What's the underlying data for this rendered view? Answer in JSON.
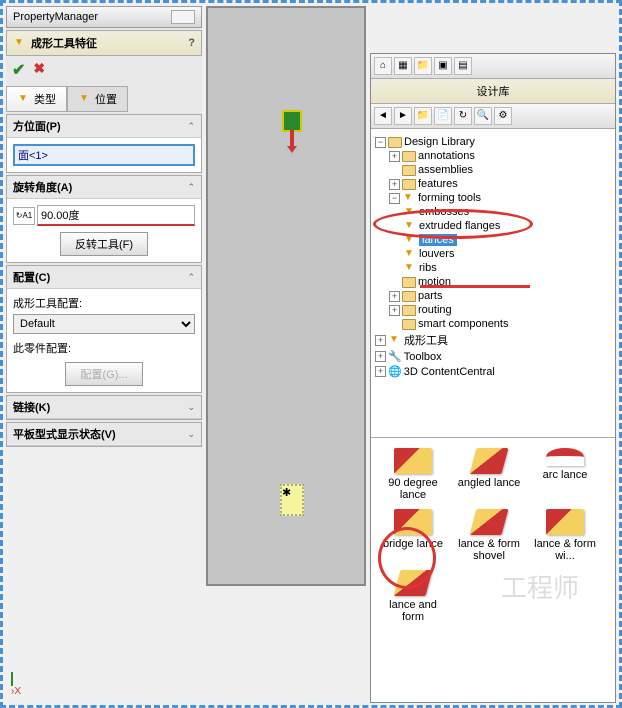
{
  "pm": {
    "title": "PropertyManager",
    "feature_title": "成形工具特征",
    "tab_type": "类型",
    "tab_position": "位置",
    "sec_face": "方位面(P)",
    "face_value": "面<1>",
    "sec_angle": "旋转角度(A)",
    "angle_value": "90.00度",
    "reverse_btn": "反转工具(F)",
    "sec_config": "配置(C)",
    "config_label": "成形工具配置:",
    "config_default": "Default",
    "part_config_label": "此零件配置:",
    "config_btn": "配置(G)...",
    "sec_link": "链接(K)",
    "sec_flat": "平板型式显示状态(V)"
  },
  "lib": {
    "title": "设计库",
    "root": "Design Library",
    "items": [
      "annotations",
      "assemblies",
      "features",
      "forming tools",
      "embosses",
      "extruded flanges",
      "lances",
      "louvers",
      "ribs",
      "motion",
      "parts",
      "routing",
      "smart components"
    ],
    "cn_item": "成形工具",
    "toolbox": "Toolbox",
    "content": "3D ContentCentral"
  },
  "thumbs": [
    {
      "label": "90 degree lance"
    },
    {
      "label": "angled lance"
    },
    {
      "label": "arc lance"
    },
    {
      "label": "bridge lance"
    },
    {
      "label": "lance & form shovel"
    },
    {
      "label": "lance & form wi..."
    },
    {
      "label": "lance and form"
    }
  ],
  "watermark": "工程师"
}
